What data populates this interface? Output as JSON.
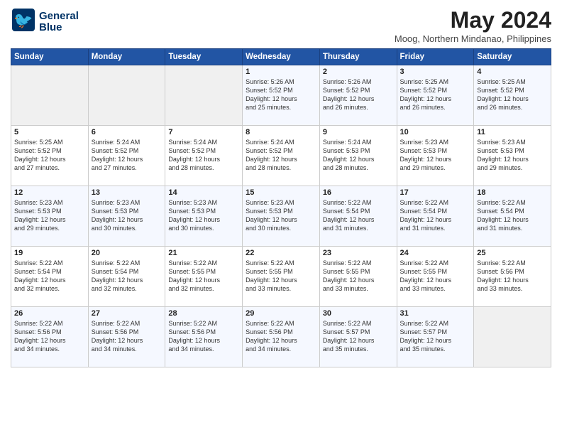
{
  "logo": {
    "line1": "General",
    "line2": "Blue"
  },
  "title": "May 2024",
  "location": "Moog, Northern Mindanao, Philippines",
  "weekdays": [
    "Sunday",
    "Monday",
    "Tuesday",
    "Wednesday",
    "Thursday",
    "Friday",
    "Saturday"
  ],
  "weeks": [
    [
      {
        "day": "",
        "info": ""
      },
      {
        "day": "",
        "info": ""
      },
      {
        "day": "",
        "info": ""
      },
      {
        "day": "1",
        "info": "Sunrise: 5:26 AM\nSunset: 5:52 PM\nDaylight: 12 hours\nand 25 minutes."
      },
      {
        "day": "2",
        "info": "Sunrise: 5:26 AM\nSunset: 5:52 PM\nDaylight: 12 hours\nand 26 minutes."
      },
      {
        "day": "3",
        "info": "Sunrise: 5:25 AM\nSunset: 5:52 PM\nDaylight: 12 hours\nand 26 minutes."
      },
      {
        "day": "4",
        "info": "Sunrise: 5:25 AM\nSunset: 5:52 PM\nDaylight: 12 hours\nand 26 minutes."
      }
    ],
    [
      {
        "day": "5",
        "info": "Sunrise: 5:25 AM\nSunset: 5:52 PM\nDaylight: 12 hours\nand 27 minutes."
      },
      {
        "day": "6",
        "info": "Sunrise: 5:24 AM\nSunset: 5:52 PM\nDaylight: 12 hours\nand 27 minutes."
      },
      {
        "day": "7",
        "info": "Sunrise: 5:24 AM\nSunset: 5:52 PM\nDaylight: 12 hours\nand 28 minutes."
      },
      {
        "day": "8",
        "info": "Sunrise: 5:24 AM\nSunset: 5:52 PM\nDaylight: 12 hours\nand 28 minutes."
      },
      {
        "day": "9",
        "info": "Sunrise: 5:24 AM\nSunset: 5:53 PM\nDaylight: 12 hours\nand 28 minutes."
      },
      {
        "day": "10",
        "info": "Sunrise: 5:23 AM\nSunset: 5:53 PM\nDaylight: 12 hours\nand 29 minutes."
      },
      {
        "day": "11",
        "info": "Sunrise: 5:23 AM\nSunset: 5:53 PM\nDaylight: 12 hours\nand 29 minutes."
      }
    ],
    [
      {
        "day": "12",
        "info": "Sunrise: 5:23 AM\nSunset: 5:53 PM\nDaylight: 12 hours\nand 29 minutes."
      },
      {
        "day": "13",
        "info": "Sunrise: 5:23 AM\nSunset: 5:53 PM\nDaylight: 12 hours\nand 30 minutes."
      },
      {
        "day": "14",
        "info": "Sunrise: 5:23 AM\nSunset: 5:53 PM\nDaylight: 12 hours\nand 30 minutes."
      },
      {
        "day": "15",
        "info": "Sunrise: 5:23 AM\nSunset: 5:53 PM\nDaylight: 12 hours\nand 30 minutes."
      },
      {
        "day": "16",
        "info": "Sunrise: 5:22 AM\nSunset: 5:54 PM\nDaylight: 12 hours\nand 31 minutes."
      },
      {
        "day": "17",
        "info": "Sunrise: 5:22 AM\nSunset: 5:54 PM\nDaylight: 12 hours\nand 31 minutes."
      },
      {
        "day": "18",
        "info": "Sunrise: 5:22 AM\nSunset: 5:54 PM\nDaylight: 12 hours\nand 31 minutes."
      }
    ],
    [
      {
        "day": "19",
        "info": "Sunrise: 5:22 AM\nSunset: 5:54 PM\nDaylight: 12 hours\nand 32 minutes."
      },
      {
        "day": "20",
        "info": "Sunrise: 5:22 AM\nSunset: 5:54 PM\nDaylight: 12 hours\nand 32 minutes."
      },
      {
        "day": "21",
        "info": "Sunrise: 5:22 AM\nSunset: 5:55 PM\nDaylight: 12 hours\nand 32 minutes."
      },
      {
        "day": "22",
        "info": "Sunrise: 5:22 AM\nSunset: 5:55 PM\nDaylight: 12 hours\nand 33 minutes."
      },
      {
        "day": "23",
        "info": "Sunrise: 5:22 AM\nSunset: 5:55 PM\nDaylight: 12 hours\nand 33 minutes."
      },
      {
        "day": "24",
        "info": "Sunrise: 5:22 AM\nSunset: 5:55 PM\nDaylight: 12 hours\nand 33 minutes."
      },
      {
        "day": "25",
        "info": "Sunrise: 5:22 AM\nSunset: 5:56 PM\nDaylight: 12 hours\nand 33 minutes."
      }
    ],
    [
      {
        "day": "26",
        "info": "Sunrise: 5:22 AM\nSunset: 5:56 PM\nDaylight: 12 hours\nand 34 minutes."
      },
      {
        "day": "27",
        "info": "Sunrise: 5:22 AM\nSunset: 5:56 PM\nDaylight: 12 hours\nand 34 minutes."
      },
      {
        "day": "28",
        "info": "Sunrise: 5:22 AM\nSunset: 5:56 PM\nDaylight: 12 hours\nand 34 minutes."
      },
      {
        "day": "29",
        "info": "Sunrise: 5:22 AM\nSunset: 5:56 PM\nDaylight: 12 hours\nand 34 minutes."
      },
      {
        "day": "30",
        "info": "Sunrise: 5:22 AM\nSunset: 5:57 PM\nDaylight: 12 hours\nand 35 minutes."
      },
      {
        "day": "31",
        "info": "Sunrise: 5:22 AM\nSunset: 5:57 PM\nDaylight: 12 hours\nand 35 minutes."
      },
      {
        "day": "",
        "info": ""
      }
    ]
  ]
}
